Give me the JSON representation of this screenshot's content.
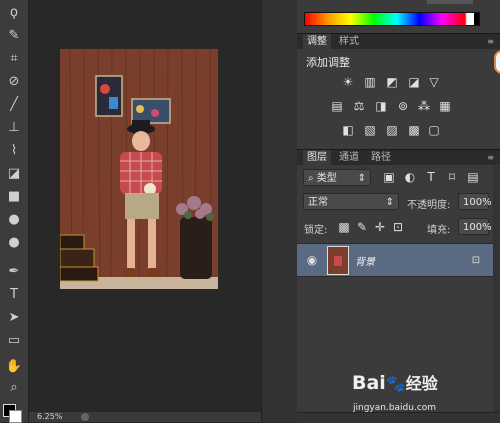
{
  "tools": [
    {
      "name": "lasso-icon",
      "glyph": "ϙ"
    },
    {
      "name": "brush-tool-icon",
      "glyph": "✎"
    },
    {
      "name": "crop-icon",
      "glyph": "⌗"
    },
    {
      "name": "eyedropper-icon",
      "glyph": "⁄"
    },
    {
      "name": "healing-brush-icon",
      "glyph": "⊘"
    },
    {
      "name": "brush-icon",
      "glyph": "╱"
    },
    {
      "name": "clone-stamp-icon",
      "glyph": "⊥"
    },
    {
      "name": "history-brush-icon",
      "glyph": "⌇"
    },
    {
      "name": "eraser-icon",
      "glyph": "◪"
    },
    {
      "name": "gradient-icon",
      "glyph": "■"
    },
    {
      "name": "blur-icon",
      "glyph": "●"
    },
    {
      "name": "dodge-icon",
      "glyph": "●"
    },
    {
      "name": "pen-icon",
      "glyph": "✒"
    },
    {
      "name": "type-icon",
      "glyph": "T"
    },
    {
      "name": "path-selection-icon",
      "glyph": "➤"
    },
    {
      "name": "rectangle-icon",
      "glyph": "▭"
    },
    {
      "name": "hand-icon",
      "glyph": "✋"
    },
    {
      "name": "zoom-icon",
      "glyph": "🔍"
    }
  ],
  "status": {
    "zoom": "6.25%"
  },
  "adjustments": {
    "tab_label": "调整",
    "styles_tab_label": "样式",
    "add_label": "添加调整"
  },
  "layers_panel": {
    "tabs": [
      "图层",
      "通道",
      "路径"
    ],
    "filter_label": "类型",
    "blend_mode": "正常",
    "opacity_label": "不透明度:",
    "opacity_value": "100%",
    "lock_label": "锁定:",
    "fill_label": "填充:",
    "fill_value": "100%",
    "layer_name": "背景"
  },
  "watermark": {
    "brand": "Bai",
    "suffix": "经验",
    "url": "jingyan.baidu.com"
  },
  "colors": {
    "accent": "#596a82",
    "panel": "#3b3b3b",
    "workarea": "#282828"
  }
}
